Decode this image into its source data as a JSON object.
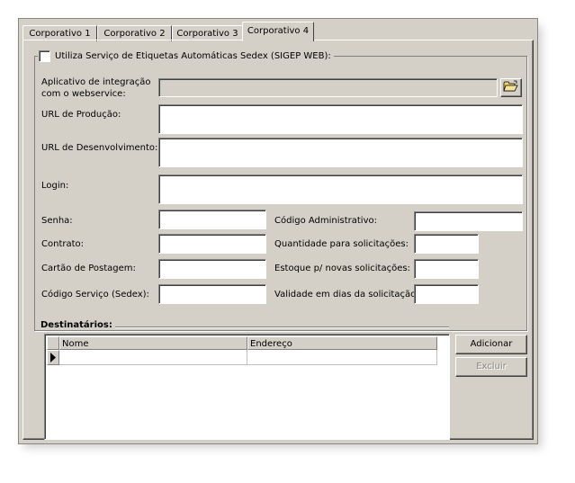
{
  "tabs": [
    {
      "label": "Corporativo 1"
    },
    {
      "label": "Corporativo 2"
    },
    {
      "label": "Corporativo 3"
    },
    {
      "label": "Corporativo 4"
    }
  ],
  "sigep": {
    "checkbox_label": "Utiliza Serviço de Etiquetas Automáticas Sedex (SIGEP WEB):",
    "checked": false
  },
  "fields": {
    "app_label_line1": "Aplicativo de integração",
    "app_label_line2": "com o webservice:",
    "url_producao": "URL de Produção:",
    "url_desenvolvimento": "URL de Desenvolvimento:",
    "login": "Login:",
    "senha": "Senha:",
    "contrato": "Contrato:",
    "cartao": "Cartão de Postagem:",
    "codigo_servico": "Código Serviço (Sedex):",
    "codigo_admin": "Código Administrativo:",
    "qtd_solicitacoes": "Quantidade para solicitações:",
    "estoque": "Estoque p/ novas solicitações:",
    "validade": "Validade em dias da solicitação:"
  },
  "destinatarios": {
    "title": "Destinatários:",
    "columns": [
      "Nome",
      "Endereço"
    ],
    "add_button": "Adicionar",
    "delete_button": "Excluir"
  },
  "icons": {
    "browse": "folder-open-icon",
    "row_indicator": "row-pointer-icon"
  }
}
